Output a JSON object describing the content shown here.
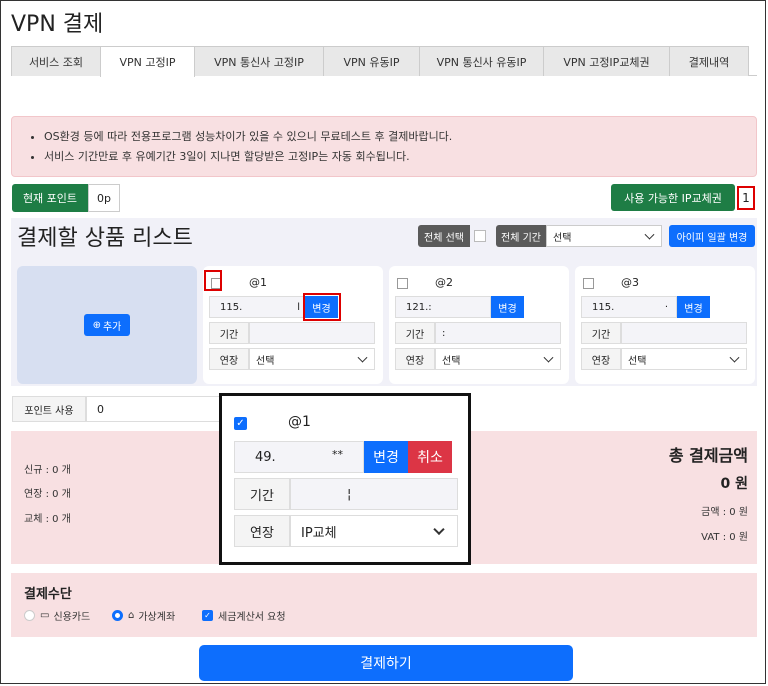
{
  "title": "VPN 결제",
  "tabs": [
    "서비스 조회",
    "VPN 고정IP",
    "VPN 통신사 고정IP",
    "VPN 유동IP",
    "VPN 통신사 유동IP",
    "VPN 고정IP교체권",
    "결제내역"
  ],
  "active_tab": 1,
  "alert": [
    "OS환경 등에 따라 전용프로그램 성능차이가 있을 수 있으니 무료테스트 후 결제바랍니다.",
    "서비스 기간만료 후 유예기간 3일이 지나면 할당받은 고정IP는 자동 회수됩니다."
  ],
  "points": {
    "label": "현재 포인트",
    "value": "0p"
  },
  "ip_change": {
    "label": "사용 가능한 IP교체권",
    "count": "1"
  },
  "list": {
    "title": "결제할 상품 리스트",
    "select_all": "전체 선택",
    "all_period": "전체 기간",
    "period_select": "선택",
    "ip_bulk_change": "아이피 일괄 변경",
    "add": "추가"
  },
  "cards": [
    {
      "no": "@1",
      "ip": "115.",
      "ip_tail": "l",
      "change": "변경",
      "period_label": "기간",
      "period_value": "",
      "extend_label": "연장",
      "extend_value": "선택"
    },
    {
      "no": "@2",
      "ip": "121.:",
      "ip_tail": "",
      "change": "변경",
      "period_label": "기간",
      "period_value": ":",
      "extend_label": "연장",
      "extend_value": "선택"
    },
    {
      "no": "@3",
      "ip": "115.",
      "ip_tail": "·",
      "change": "변경",
      "period_label": "기간",
      "period_value": "",
      "extend_label": "연장",
      "extend_value": "선택"
    }
  ],
  "point_use": {
    "label": "포인트 사용",
    "value": "0"
  },
  "summary": {
    "new": "신규 : 0 개",
    "extend": "연장 : 0 개",
    "swap": "교체 : 0 개",
    "total_label": "총 결제금액",
    "total_value": "0 원",
    "amount": "금액 : 0 원",
    "vat": "VAT : 0 원"
  },
  "payment": {
    "title": "결제수단",
    "card": "신용카드",
    "account": "가상계좌",
    "tax": "세금계산서 요청"
  },
  "pay_button": "결제하기",
  "zoom": {
    "no": "@1",
    "ip": "49.",
    "ip_mask": "**",
    "change": "변경",
    "cancel": "취소",
    "period_label": "기간",
    "period_value": "¦",
    "extend_label": "연장",
    "extend_value": "IP교체"
  }
}
